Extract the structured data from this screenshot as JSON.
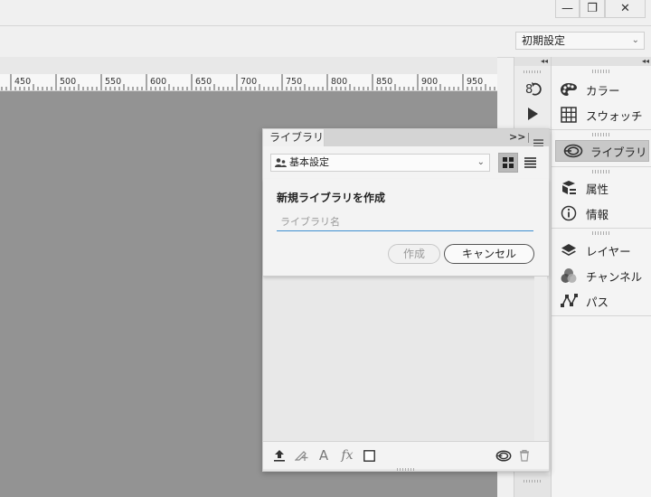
{
  "window": {
    "minimize_label": "—",
    "restore_label": "❐",
    "close_label": "✕"
  },
  "options_bar": {
    "workspace_value": "初期設定"
  },
  "ruler": {
    "labels": [
      "450",
      "500",
      "550",
      "600",
      "650",
      "700",
      "750",
      "800",
      "850",
      "900",
      "950"
    ]
  },
  "tool_column": {
    "collapse_label": "◂◂",
    "icons": [
      "history-icon",
      "play-action-icon"
    ]
  },
  "dock": {
    "collapse_label": "◂◂",
    "items": [
      {
        "label": "カラー",
        "icon": "color-palette-icon"
      },
      {
        "label": "スウォッチ",
        "icon": "swatches-grid-icon"
      },
      {
        "label": "ライブラリ",
        "icon": "libraries-icon"
      },
      {
        "label": "属性",
        "icon": "properties-icon"
      },
      {
        "label": "情報",
        "icon": "info-icon"
      },
      {
        "label": "レイヤー",
        "icon": "layers-icon"
      },
      {
        "label": "チャンネル",
        "icon": "channels-icon"
      },
      {
        "label": "パス",
        "icon": "paths-icon"
      }
    ]
  },
  "library_panel": {
    "tab_label": "ライブラリ",
    "expand_label": ">>",
    "library_select": "基本設定",
    "dialog": {
      "title": "新規ライブラリを作成",
      "name_placeholder": "ライブラリ名",
      "create_label": "作成",
      "cancel_label": "キャンセル"
    },
    "footer": {
      "text_icon_label": "A",
      "fx_label": "fx"
    }
  },
  "colors": {
    "canvas_gray": "#939393",
    "accent_blue": "#3e8ed0",
    "panel_bg": "#f3f3f3"
  }
}
